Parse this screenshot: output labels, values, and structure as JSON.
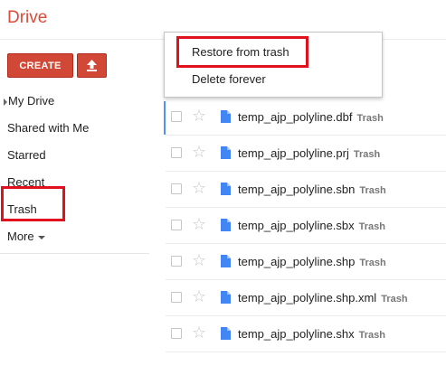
{
  "app": {
    "title": "Drive"
  },
  "toolbar": {
    "create_label": "CREATE",
    "upload_icon": "upload-arrow-icon"
  },
  "sidebar": {
    "items": [
      {
        "label": "My Drive"
      },
      {
        "label": "Shared with Me"
      },
      {
        "label": "Starred"
      },
      {
        "label": "Recent"
      },
      {
        "label": "Trash"
      },
      {
        "label": "More"
      }
    ]
  },
  "context_menu": {
    "items": [
      {
        "label": "Restore from trash"
      },
      {
        "label": "Delete forever"
      }
    ]
  },
  "files": [
    {
      "name": "temp_ajp_polyline.dbf",
      "tag": "Trash"
    },
    {
      "name": "temp_ajp_polyline.prj",
      "tag": "Trash"
    },
    {
      "name": "temp_ajp_polyline.sbn",
      "tag": "Trash"
    },
    {
      "name": "temp_ajp_polyline.sbx",
      "tag": "Trash"
    },
    {
      "name": "temp_ajp_polyline.shp",
      "tag": "Trash"
    },
    {
      "name": "temp_ajp_polyline.shp.xml",
      "tag": "Trash"
    },
    {
      "name": "temp_ajp_polyline.shx",
      "tag": "Trash"
    }
  ],
  "colors": {
    "brand": "#dd4b39",
    "create_button": "#d14836",
    "highlight": "#e0111d",
    "doc_icon": "#4285f4"
  }
}
